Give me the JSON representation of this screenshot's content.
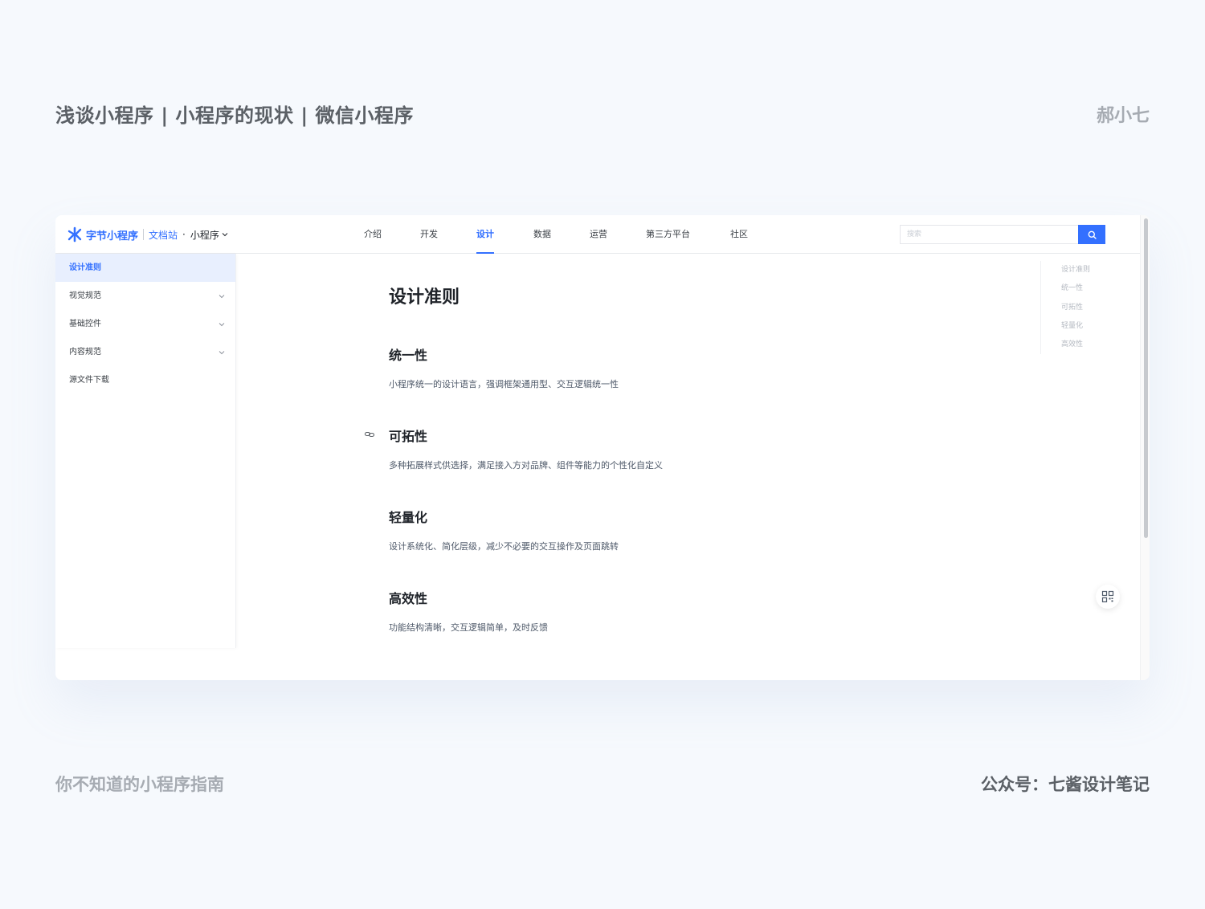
{
  "slide": {
    "title": "浅谈小程序 | 小程序的现状 | 微信小程序",
    "author": "郝小七",
    "footer_left": "你不知道的小程序指南",
    "footer_right": "公众号：七酱设计笔记"
  },
  "header": {
    "brand_name": "字节小程序",
    "doc_site": "文档站",
    "dot": "·",
    "product": "小程序",
    "nav": [
      {
        "label": "介绍"
      },
      {
        "label": "开发"
      },
      {
        "label": "设计",
        "active": true
      },
      {
        "label": "数据"
      },
      {
        "label": "运营"
      },
      {
        "label": "第三方平台"
      },
      {
        "label": "社区"
      }
    ],
    "search_placeholder": "搜索"
  },
  "sidebar": {
    "items": [
      {
        "label": "设计准则",
        "active": true,
        "expandable": false
      },
      {
        "label": "视觉规范",
        "expandable": true
      },
      {
        "label": "基础控件",
        "expandable": true
      },
      {
        "label": "内容规范",
        "expandable": true
      },
      {
        "label": "源文件下载",
        "expandable": false
      }
    ]
  },
  "content": {
    "title": "设计准则",
    "sections": [
      {
        "title": "统一性",
        "desc": "小程序统一的设计语言，强调框架通用型、交互逻辑统一性"
      },
      {
        "title": "可拓性",
        "desc": "多种拓展样式供选择，满足接入方对品牌、组件等能力的个性化自定义"
      },
      {
        "title": "轻量化",
        "desc": "设计系统化、简化层级，减少不必要的交互操作及页面跳转"
      },
      {
        "title": "高效性",
        "desc": "功能结构清晰，交互逻辑简单，及时反馈"
      }
    ]
  },
  "toc": {
    "items": [
      "设计准则",
      "统一性",
      "可拓性",
      "轻量化",
      "高效性"
    ]
  },
  "colors": {
    "accent": "#3370ff",
    "sidebar_active_bg": "#e8effe",
    "text_primary": "#1f2329",
    "text_muted": "#b4b9c1"
  },
  "icons": {
    "brand": "bytedance-miniapp-logo-icon",
    "chevron": "chevron-down-icon",
    "search": "search-icon",
    "anchor": "link-icon",
    "qr": "qr-code-icon"
  }
}
